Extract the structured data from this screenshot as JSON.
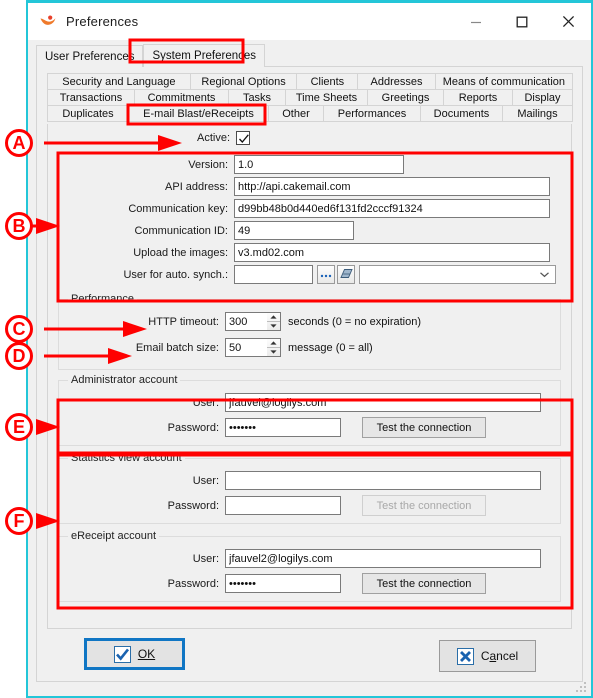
{
  "window": {
    "title": "Preferences",
    "app_icon": "swoosh-logo-icon",
    "minimize_label": "Minimize",
    "maximize_label": "Maximize",
    "close_label": "Close"
  },
  "outer_tabs": [
    {
      "label": "User Preferences",
      "active": false
    },
    {
      "label": "System Preferences",
      "active": true
    }
  ],
  "inner_tabs": {
    "row1": [
      "Security and Language",
      "Regional Options",
      "Clients",
      "Addresses",
      "Means of communication"
    ],
    "row2": [
      "Transactions",
      "Commitments",
      "Tasks",
      "Time Sheets",
      "Greetings",
      "Reports",
      "Display"
    ],
    "row3": [
      "Duplicates",
      "E-mail Blast/eReceipts",
      "Other",
      "Performances",
      "Documents",
      "Mailings"
    ],
    "active": "E-mail Blast/eReceipts"
  },
  "form": {
    "active_label": "Active:",
    "active_checked": true,
    "version_label": "Version:",
    "version_value": "1.0",
    "api_address_label": "API address:",
    "api_address_value": "http://api.cakemail.com",
    "comm_key_label": "Communication key:",
    "comm_key_value": "d99bb48b0d440ed6f131fd2cccf91324",
    "comm_id_label": "Communication ID:",
    "comm_id_value": "49",
    "upload_images_label": "Upload the images:",
    "upload_images_value": "v3.md02.com",
    "auto_sync_label": "User for auto. synch.:",
    "auto_sync_value": "",
    "browse_button_icon": "ellipsis-icon",
    "erase_button_icon": "eraser-icon",
    "auto_sync_combo_value": "",
    "combo_icon": "chevron-down-icon"
  },
  "performance": {
    "group_title": "Performance",
    "http_timeout_label": "HTTP timeout:",
    "http_timeout_value": "300",
    "http_timeout_suffix": "seconds (0 = no expiration)",
    "email_batch_label": "Email batch size:",
    "email_batch_value": "50",
    "email_batch_suffix": "message (0 = all)",
    "spinner_up_icon": "caret-up-icon",
    "spinner_down_icon": "caret-down-icon"
  },
  "admin_account": {
    "group_title": "Administrator account",
    "user_label": "User:",
    "user_value": "jfauvel@logilys.com",
    "password_label": "Password:",
    "password_value": "•••••••",
    "test_button": "Test the connection",
    "test_button_enabled": true
  },
  "stats_account": {
    "group_title": "Statistics view account",
    "user_label": "User:",
    "user_value": "",
    "password_label": "Password:",
    "password_value": "",
    "test_button": "Test the connection",
    "test_button_enabled": false
  },
  "ereceipt_account": {
    "group_title": "eReceipt account",
    "user_label": "User:",
    "user_value": "jfauvel2@logilys.com",
    "password_label": "Password:",
    "password_value": "•••••••",
    "test_button": "Test the connection",
    "test_button_enabled": true
  },
  "footer": {
    "ok_label": "OK",
    "ok_icon": "checkmark-icon",
    "cancel_label": "Cancel",
    "cancel_icon": "x-mark-icon"
  },
  "annotations": {
    "color": "#ff0000",
    "markers": [
      {
        "letter": "A",
        "target": "active-checkbox-row"
      },
      {
        "letter": "B",
        "target": "connection-settings-block"
      },
      {
        "letter": "C",
        "target": "http-timeout-field"
      },
      {
        "letter": "D",
        "target": "email-batch-size-field"
      },
      {
        "letter": "E",
        "target": "administrator-account-group"
      },
      {
        "letter": "F",
        "target": "statistics-and-ereceipt-groups"
      }
    ]
  }
}
